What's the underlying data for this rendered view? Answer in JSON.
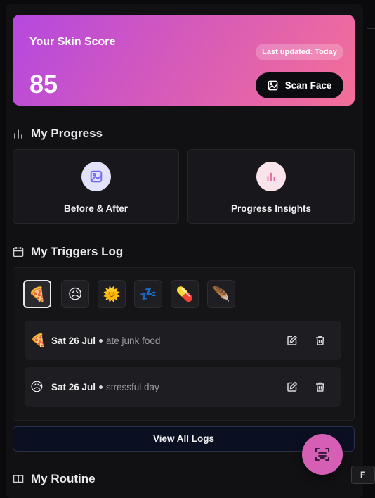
{
  "score_card": {
    "title": "Your Skin Score",
    "score": "85",
    "updated": "Last updated: Today",
    "scan_label": "Scan Face"
  },
  "progress": {
    "title": "My Progress",
    "tiles": [
      {
        "label": "Before & After",
        "icon": "image-icon",
        "color": "#6c63ff"
      },
      {
        "label": "Progress Insights",
        "icon": "bar-chart-icon",
        "color": "#e5659b"
      }
    ]
  },
  "triggers": {
    "title": "My Triggers Log",
    "types": [
      {
        "emoji": "🍕",
        "name": "junk-food",
        "active": true
      },
      {
        "emoji": "😥",
        "name": "stress"
      },
      {
        "emoji": "🌞",
        "name": "sun"
      },
      {
        "emoji": "💤",
        "name": "sleep"
      },
      {
        "emoji": "💊",
        "name": "medication"
      },
      {
        "emoji": "🪶",
        "name": "other"
      }
    ],
    "logs": [
      {
        "emoji": "🍕",
        "date": "Sat 26 Jul",
        "note": "ate junk food"
      },
      {
        "emoji": "😥",
        "date": "Sat 26 Jul",
        "note": "stressful day"
      }
    ],
    "view_all_label": "View All Logs"
  },
  "routine": {
    "title": "My Routine"
  },
  "tooltip_chip": "F",
  "colors": {
    "gradient_start": "#b548e0",
    "gradient_end": "#f46f98",
    "fab": "#d45fb4"
  }
}
